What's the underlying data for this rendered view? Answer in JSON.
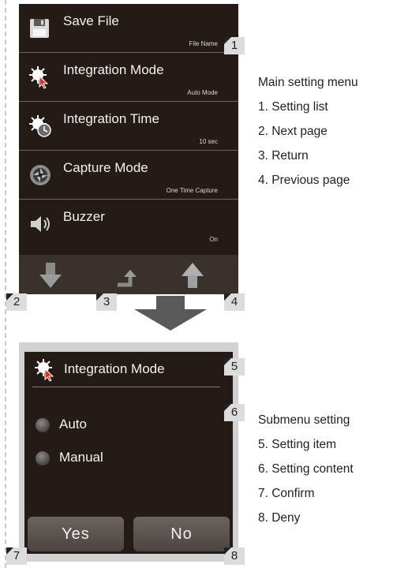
{
  "main_menu": {
    "items": [
      {
        "title": "Save File",
        "value": "File Name",
        "icon": "floppy-disk-icon"
      },
      {
        "title": "Integration Mode",
        "value": "Auto Mode",
        "icon": "integration-mode-icon"
      },
      {
        "title": "Integration Time",
        "value": "10 sec",
        "icon": "integration-time-icon"
      },
      {
        "title": "Capture Mode",
        "value": "One Time Capture",
        "icon": "capture-mode-icon"
      },
      {
        "title": "Buzzer",
        "value": "On",
        "icon": "speaker-icon"
      }
    ],
    "nav": {
      "next": "down-arrow-icon",
      "return": "return-arrow-icon",
      "previous": "up-arrow-icon"
    }
  },
  "submenu": {
    "title": "Integration Mode",
    "options": [
      "Auto",
      "Manual"
    ],
    "yes_label": "Yes",
    "no_label": "No"
  },
  "callouts": [
    "1",
    "2",
    "3",
    "4",
    "5",
    "6",
    "7",
    "8"
  ],
  "descriptions": {
    "main": {
      "heading": "Main setting menu",
      "lines": [
        "1. Setting list",
        "2. Next page",
        "3. Return",
        "4. Previous page"
      ]
    },
    "sub": {
      "heading": "Submenu setting",
      "lines": [
        "5. Setting item",
        "6. Setting content",
        "7. Confirm",
        "8. Deny"
      ]
    }
  },
  "colors": {
    "screen_bg": "#241a16",
    "nav_bg": "#3a302c",
    "frame": "#d2d2d2",
    "callout_bg": "#dcdcdc",
    "accent_red": "#e0301e"
  }
}
